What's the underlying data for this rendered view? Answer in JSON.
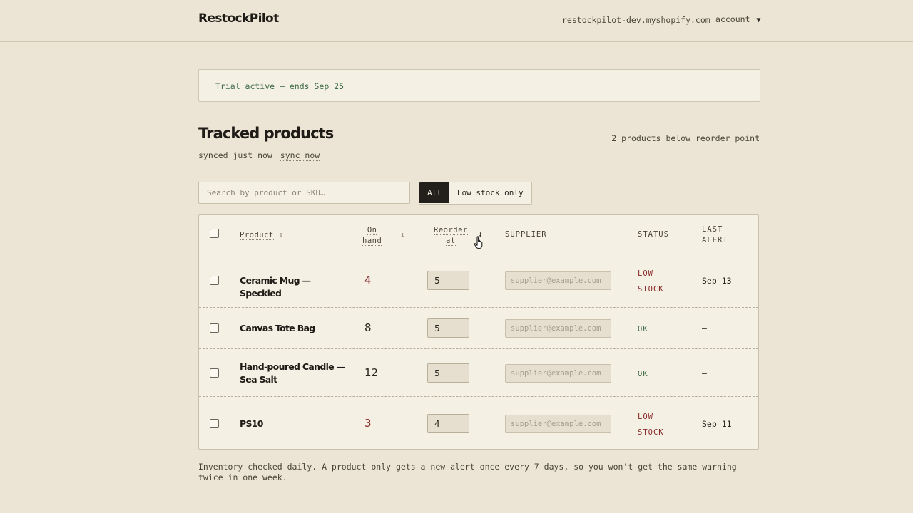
{
  "header": {
    "brand": "RestockPilot",
    "store": "restockpilot-dev.myshopify.com",
    "account_label": "account",
    "account_caret": "▼"
  },
  "trial_banner": "Trial active — ends Sep 25",
  "section": {
    "title": "Tracked products",
    "below_count": "2 products below reorder point",
    "synced_text": "synced just now",
    "sync_now": "sync now"
  },
  "search": {
    "placeholder": "Search by product or SKU…"
  },
  "filters": {
    "all": "All",
    "low": "Low stock only",
    "active": "All"
  },
  "table": {
    "columns": {
      "product": "Product",
      "on_hand_1": "On",
      "on_hand_2": "hand",
      "reorder_1": "Reorder",
      "reorder_2": "at",
      "supplier": "SUPPLIER",
      "status": "STATUS",
      "last_alert_1": "LAST",
      "last_alert_2": "ALERT"
    },
    "sort_icons": {
      "product": "↕",
      "on_hand": "↕",
      "reorder": "↓"
    },
    "supplier_placeholder": "supplier@example.com",
    "rows": [
      {
        "product": "Ceramic Mug — Speckled",
        "on_hand": "4",
        "reorder_at": "5",
        "status_1": "LOW",
        "status_2": "STOCK",
        "last_alert": "Sep 13"
      },
      {
        "product": "Canvas Tote Bag",
        "on_hand": "8",
        "reorder_at": "5",
        "status_1": "OK",
        "last_alert": "—"
      },
      {
        "product": "Hand-poured Candle — Sea Salt",
        "on_hand": "12",
        "reorder_at": "5",
        "status_1": "OK",
        "last_alert": "—"
      },
      {
        "product": "PS10",
        "on_hand": "3",
        "reorder_at": "4",
        "status_1": "LOW",
        "status_2": "STOCK",
        "last_alert": "Sep 11"
      }
    ]
  },
  "footnote": "Inventory checked daily. A product only gets a new alert once every 7 days, so you won't get the same warning twice in one week.",
  "colors": {
    "background": "#ece5d6",
    "low": "#8a2a2a",
    "ok": "#3f6b47",
    "active_filter": "#23201b"
  }
}
